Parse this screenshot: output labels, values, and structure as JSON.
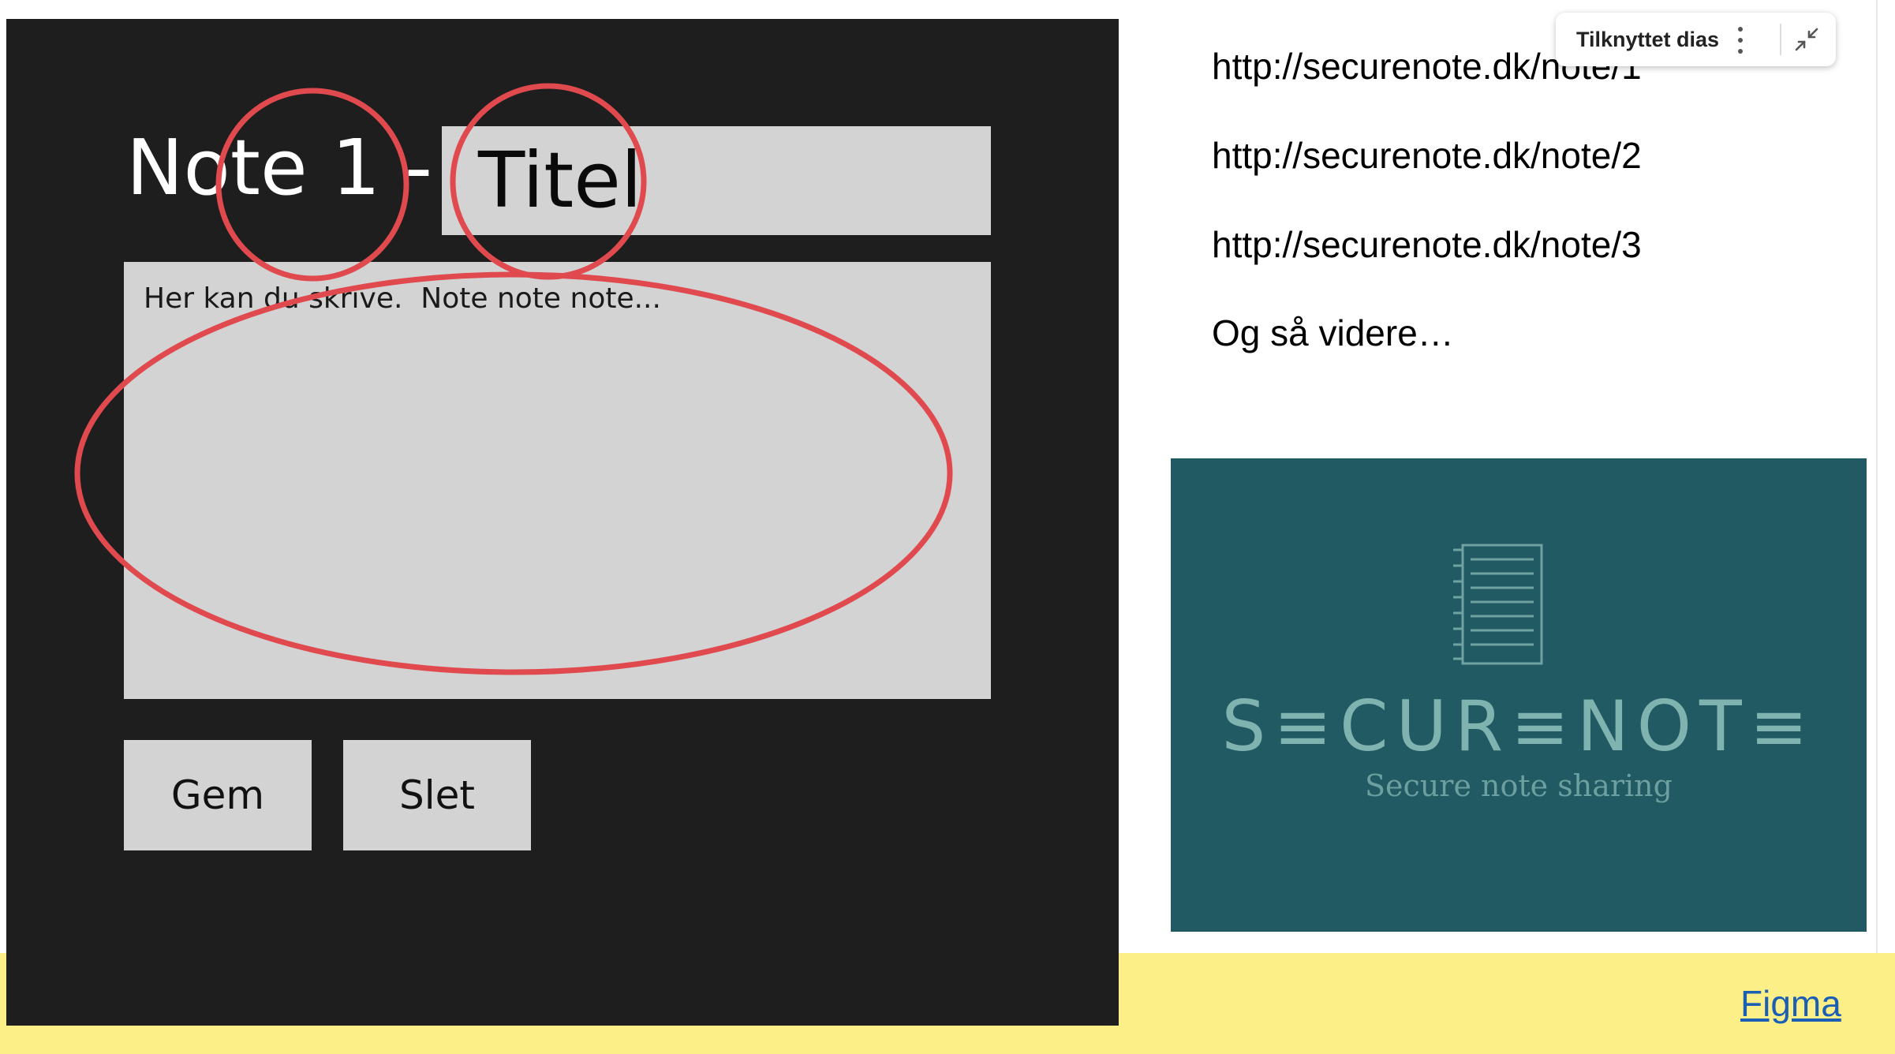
{
  "mockup": {
    "heading": "Note 1 -",
    "title_value": "Titel",
    "body_value": "Her kan du skrive.  Note note note...",
    "save_label": "Gem",
    "delete_label": "Slet"
  },
  "urls": [
    "http://securenote.dk/note/1",
    "http://securenote.dk/note/2",
    "http://securenote.dk/note/3"
  ],
  "more_text": "Og så videre…",
  "popup": {
    "label": "Tilknyttet dias",
    "icons": [
      "more-vertical-icon",
      "collapse-icon"
    ]
  },
  "logo": {
    "wordmark": "S≡CUR≡NOT≡",
    "tagline": "Secure note sharing",
    "icon": "notebook-icon"
  },
  "link_text": "Figma",
  "colors": {
    "mockup_background": "#1e1e1e",
    "field_background": "#d3d3d3",
    "annotation": "#e04a4e",
    "logo_background": "#225a63",
    "footer_band": "#fdef88",
    "link": "#1a5fb4"
  }
}
